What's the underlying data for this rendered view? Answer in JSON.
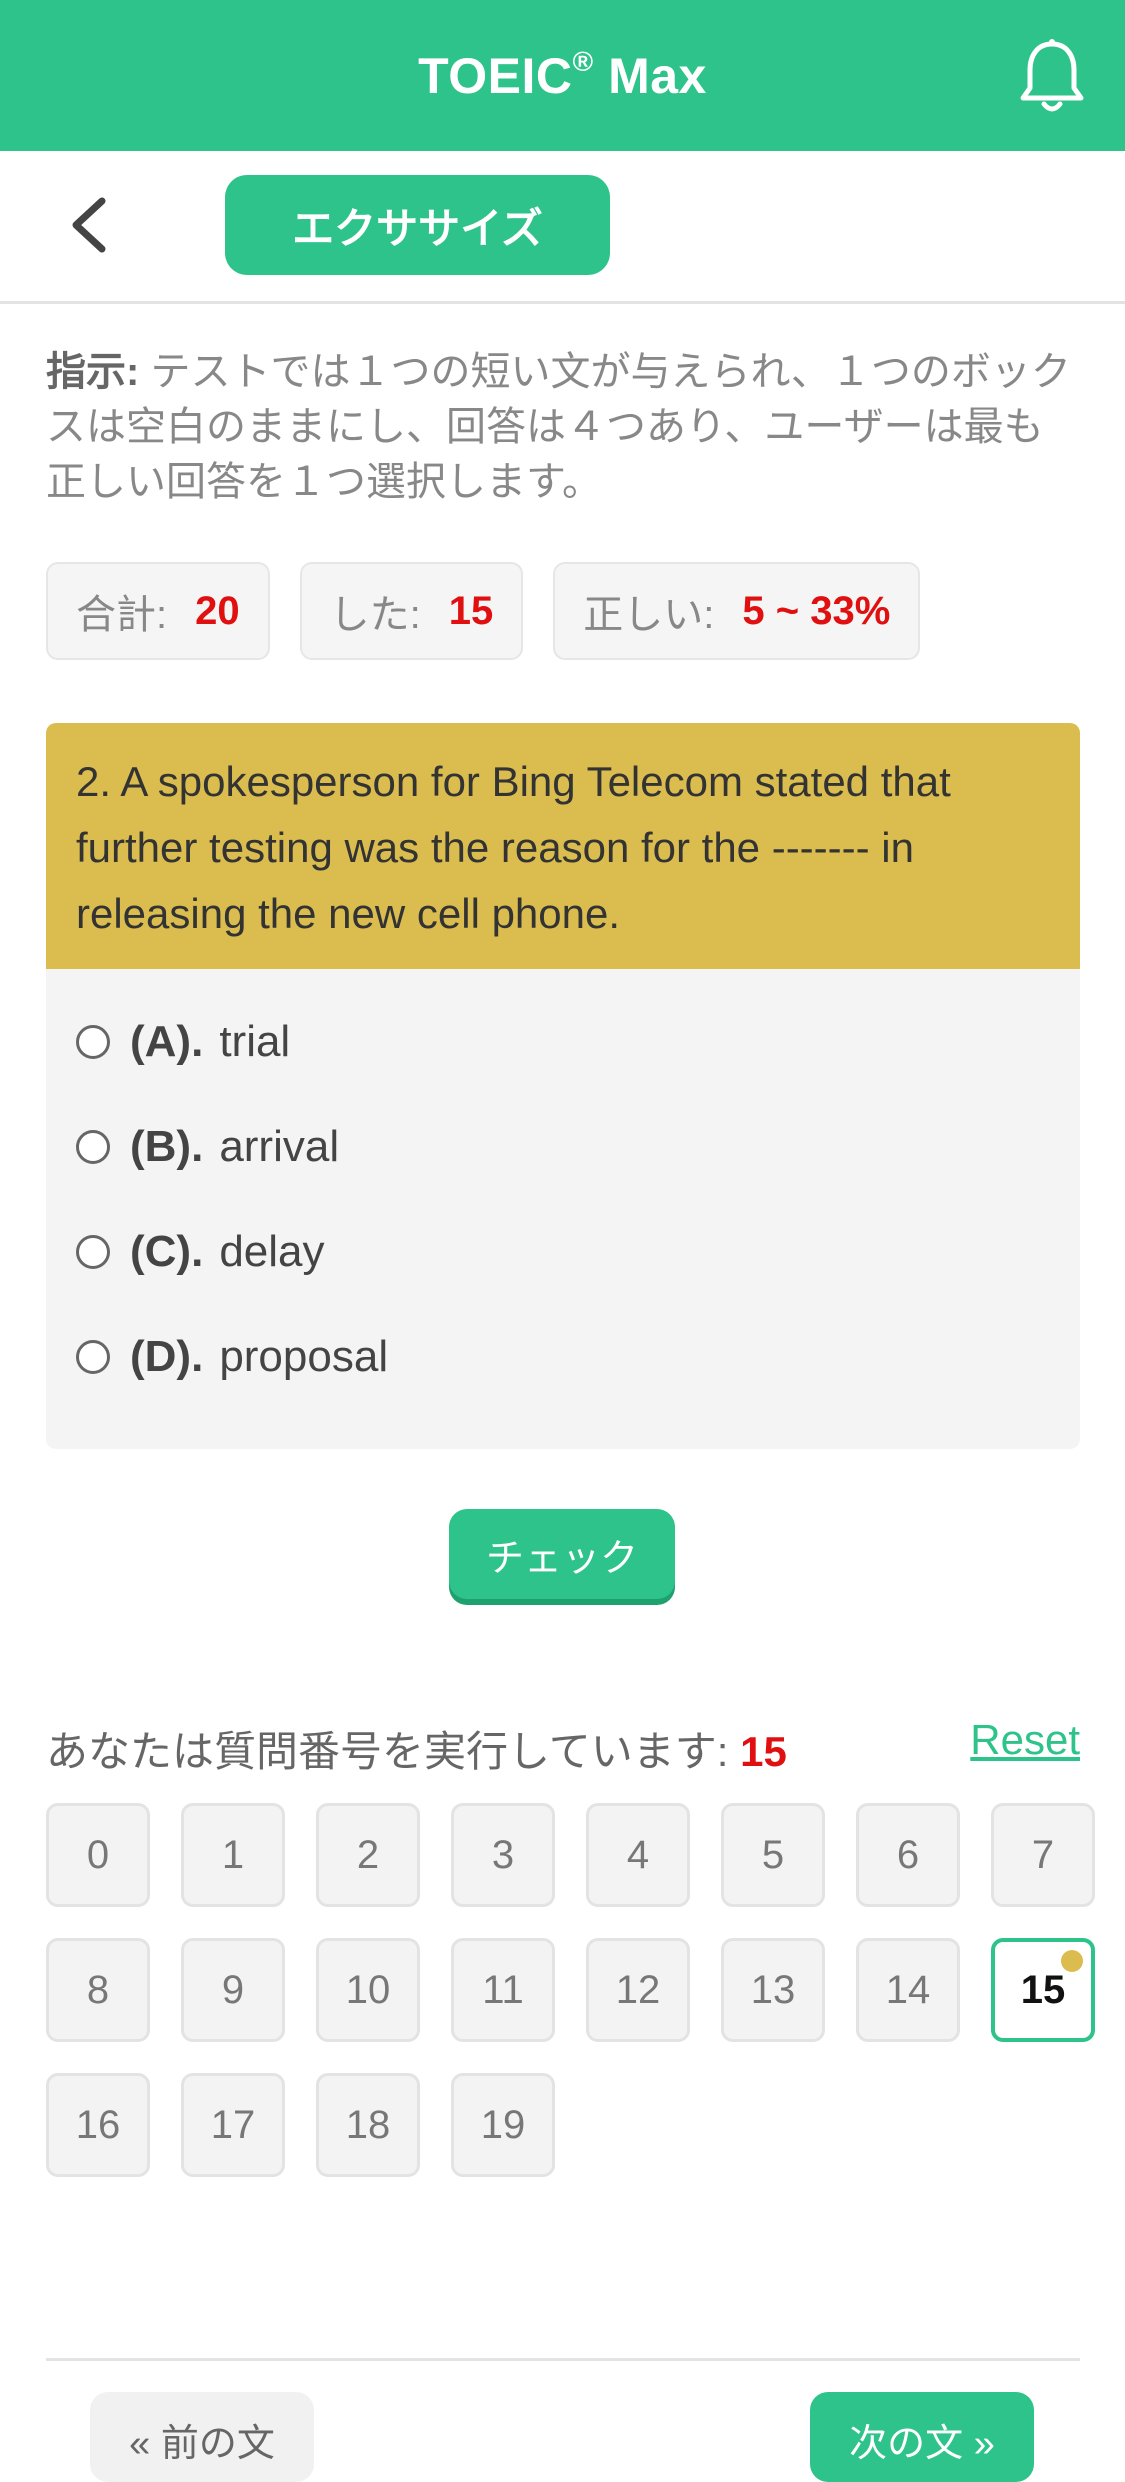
{
  "header": {
    "title": "TOEIC",
    "title_mark": "®",
    "title_suffix": " Max",
    "bell_icon": "bell-icon"
  },
  "subheader": {
    "back_icon": "chevron-left-icon",
    "exercise_label": "エクササイズ"
  },
  "instruction": {
    "label": "指示:",
    "text": " テストでは１つの短い文が与えられ、１つのボックスは空白のままにし、回答は４つあり、ユーザーは最も正しい回答を１つ選択します。"
  },
  "stats": {
    "total_label": "合計:",
    "total_value": "20",
    "done_label": "した:",
    "done_value": "15",
    "correct_label": "正しい:",
    "correct_value": "5 ~ 33%"
  },
  "question": {
    "text": "2. A spokesperson for Bing Telecom stated that further testing was the reason for the ------- in releasing the new cell phone."
  },
  "options": [
    {
      "letter": "(A).",
      "text": "trial"
    },
    {
      "letter": "(B).",
      "text": "arrival"
    },
    {
      "letter": "(C).",
      "text": "delay"
    },
    {
      "letter": "(D).",
      "text": "proposal"
    }
  ],
  "check_label": "チェック",
  "progress": {
    "label": "あなたは質問番号を実行しています: ",
    "current": "15",
    "reset_label": "Reset"
  },
  "grid": [
    "0",
    "1",
    "2",
    "3",
    "4",
    "5",
    "6",
    "7",
    "8",
    "9",
    "10",
    "11",
    "12",
    "13",
    "14",
    "15",
    "16",
    "17",
    "18",
    "19"
  ],
  "nav": {
    "prev_label": "« 前の文",
    "next_label": "次の文 »"
  },
  "colors": {
    "accent": "#2dc38a",
    "question_bg": "#dbbd4f",
    "highlight": "#e01010"
  }
}
